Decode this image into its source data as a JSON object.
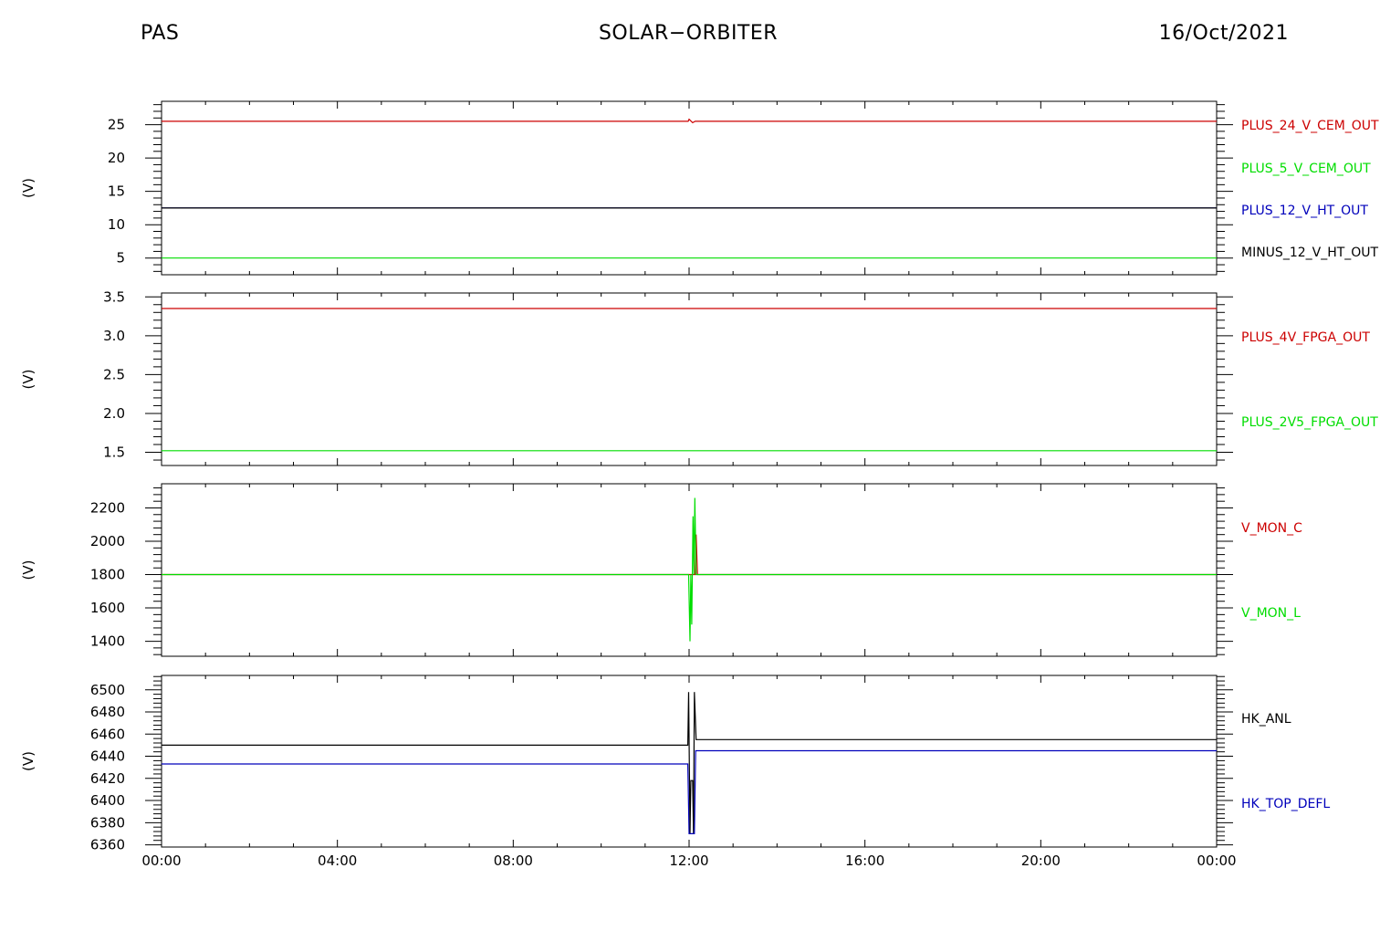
{
  "header": {
    "left": "PAS",
    "center": "SOLAR−ORBITER",
    "right": "16/Oct/2021"
  },
  "chart_data": [
    {
      "type": "line",
      "ylabel": "(V)",
      "ylim": [
        2.5,
        28.5
      ],
      "yticks": [
        5,
        10,
        15,
        20,
        25
      ],
      "ytick_labels": [
        "5",
        "10",
        "15",
        "20",
        "25"
      ],
      "xlim": [
        0,
        24
      ],
      "series": [
        {
          "name": "PLUS_24_V_CEM_OUT",
          "color": "#cc0000",
          "points": [
            [
              0,
              25.5
            ],
            [
              11.98,
              25.5
            ],
            [
              12.0,
              25.8
            ],
            [
              12.08,
              25.3
            ],
            [
              12.14,
              25.5
            ],
            [
              24,
              25.5
            ]
          ]
        },
        {
          "name": "PLUS_5_V_CEM_OUT",
          "color": "#00dd00",
          "points": [
            [
              0,
              5.0
            ],
            [
              24,
              5.0
            ]
          ]
        },
        {
          "name": "PLUS_12_V_HT_OUT",
          "color": "#0000bb",
          "points": [
            [
              0,
              12.5
            ],
            [
              24,
              12.5
            ]
          ]
        },
        {
          "name": "MINUS_12_V_HT_OUT",
          "color": "#000000",
          "points": [
            [
              0,
              12.5
            ],
            [
              24,
              12.5
            ]
          ]
        }
      ]
    },
    {
      "type": "line",
      "ylabel": "(V)",
      "ylim": [
        1.33,
        3.55
      ],
      "yticks": [
        1.5,
        2.0,
        2.5,
        3.0,
        3.5
      ],
      "ytick_labels": [
        "1.5",
        "2.0",
        "2.5",
        "3.0",
        "3.5"
      ],
      "xlim": [
        0,
        24
      ],
      "series": [
        {
          "name": "PLUS_4V_FPGA_OUT",
          "color": "#cc0000",
          "points": [
            [
              0,
              3.35
            ],
            [
              24,
              3.35
            ]
          ]
        },
        {
          "name": "PLUS_2V5_FPGA_OUT",
          "color": "#00dd00",
          "points": [
            [
              0,
              1.52
            ],
            [
              24,
              1.52
            ]
          ]
        }
      ]
    },
    {
      "type": "line",
      "ylabel": "(V)",
      "ylim": [
        1310,
        2345
      ],
      "yticks": [
        1400,
        1600,
        1800,
        2000,
        2200
      ],
      "ytick_labels": [
        "1400",
        "1600",
        "1800",
        "2000",
        "2200"
      ],
      "xlim": [
        0,
        24
      ],
      "series": [
        {
          "name": "V_MON_C",
          "color": "#cc0000",
          "points": [
            [
              0,
              1800
            ],
            [
              12.0,
              1800
            ],
            [
              12.14,
              1800
            ],
            [
              12.16,
              2040
            ],
            [
              12.19,
              1800
            ],
            [
              24,
              1800
            ]
          ]
        },
        {
          "name": "V_MON_L",
          "color": "#00dd00",
          "points": [
            [
              0,
              1800
            ],
            [
              11.99,
              1800
            ],
            [
              12.02,
              1400
            ],
            [
              12.04,
              1800
            ],
            [
              12.06,
              1500
            ],
            [
              12.09,
              2150
            ],
            [
              12.11,
              1800
            ],
            [
              12.13,
              2260
            ],
            [
              12.16,
              1800
            ],
            [
              24,
              1800
            ]
          ]
        }
      ]
    },
    {
      "type": "line",
      "ylabel": "(V)",
      "ylim": [
        6358,
        6513
      ],
      "yticks": [
        6360,
        6380,
        6400,
        6420,
        6440,
        6460,
        6480,
        6500
      ],
      "ytick_labels": [
        "6360",
        "6380",
        "6400",
        "6420",
        "6440",
        "6460",
        "6480",
        "6500"
      ],
      "xlim": [
        0,
        24
      ],
      "xticks": [
        0,
        4,
        8,
        12,
        16,
        20,
        24
      ],
      "xtick_labels": [
        "00:00",
        "04:00",
        "08:00",
        "12:00",
        "16:00",
        "20:00",
        "00:00"
      ],
      "series": [
        {
          "name": "HK_ANL",
          "color": "#000000",
          "points": [
            [
              0,
              6450
            ],
            [
              11.97,
              6450
            ],
            [
              11.99,
              6498
            ],
            [
              12.02,
              6370
            ],
            [
              12.04,
              6418
            ],
            [
              12.08,
              6418
            ],
            [
              12.1,
              6370
            ],
            [
              12.12,
              6498
            ],
            [
              12.16,
              6455
            ],
            [
              24,
              6455
            ]
          ]
        },
        {
          "name": "HK_TOP_DEFL",
          "color": "#0000bb",
          "points": [
            [
              0,
              6433
            ],
            [
              11.97,
              6433
            ],
            [
              12.0,
              6370
            ],
            [
              12.12,
              6370
            ],
            [
              12.15,
              6445
            ],
            [
              24,
              6445
            ]
          ]
        }
      ]
    }
  ]
}
